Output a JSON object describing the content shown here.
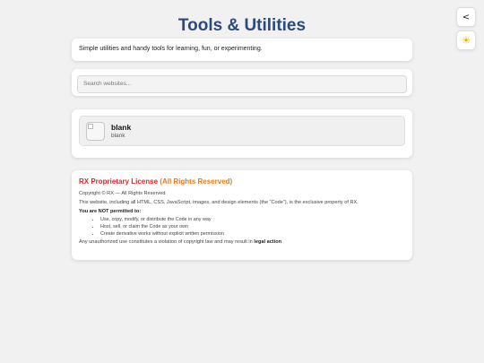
{
  "nav": {
    "back_label": "<",
    "theme_icon": "☀"
  },
  "header": {
    "title": "Tools & Utilities"
  },
  "intro": {
    "text": "Simple utilities and handy tools for learning, fun, or experimenting."
  },
  "search": {
    "placeholder": "Search websites..."
  },
  "sites": [
    {
      "name": "blank",
      "description": "blank"
    }
  ],
  "license": {
    "title_part1": "RX Proprietary License",
    "title_part2": "(All Rights Reserved)",
    "copyright": "Copyright © RX — All Rights Reserved",
    "ownership": "This website, including all HTML, CSS, JavaScript, images, and design elements (the “Code”), is the exclusive property of RX.",
    "not_permitted": "You are NOT permitted to:",
    "restrictions": [
      "Use, copy, modify, or distribute the Code in any way",
      "Host, sell, or claim the Code as your own",
      "Create derivative works without explicit written permission"
    ],
    "footer_text": "Any unauthorized use constitutes a violation of copyright law and may result in",
    "footer_bold": "legal action",
    "footer_end": "."
  },
  "colors": {
    "title": "#2a4a7f",
    "license_red": "#d62a2a",
    "license_orange": "#e87a17",
    "sun": "#f5b400"
  }
}
